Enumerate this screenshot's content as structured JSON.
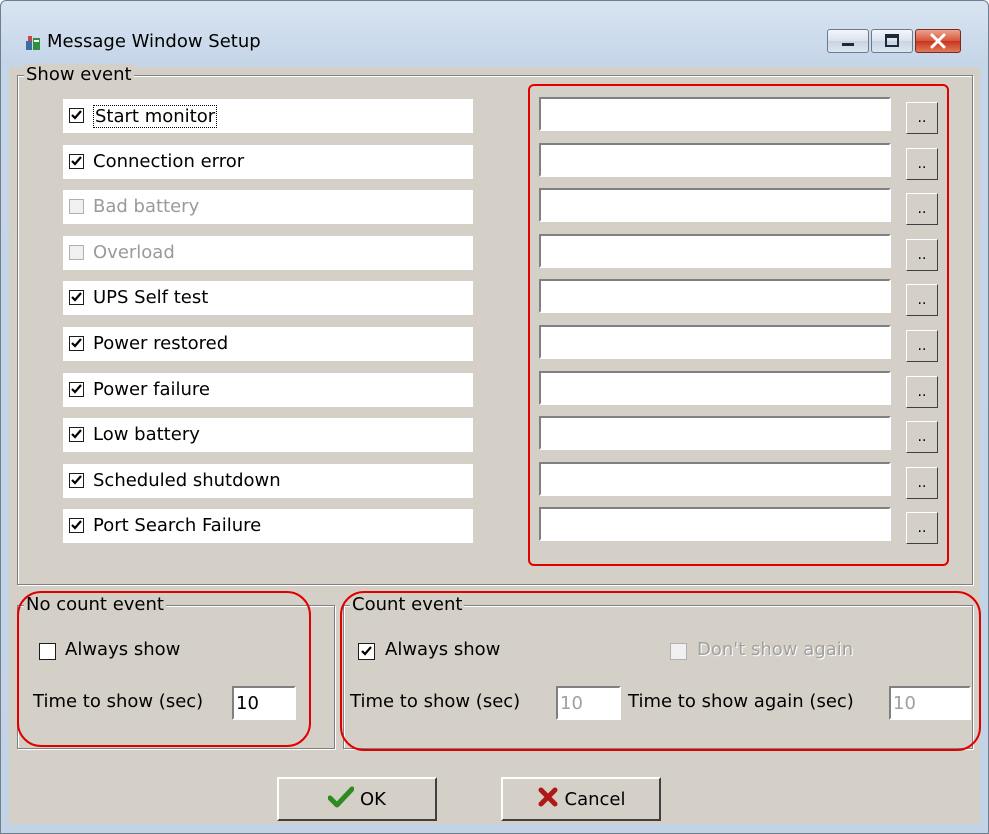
{
  "window": {
    "title": "Message Window Setup",
    "min_glyph": "▭",
    "max_glyph": "□",
    "close_glyph": "✕"
  },
  "show_event": {
    "label": "Show event",
    "browse_label": "..",
    "items": [
      {
        "label": "Start monitor",
        "checked": true,
        "enabled": true,
        "path": ""
      },
      {
        "label": "Connection error",
        "checked": true,
        "enabled": true,
        "path": ""
      },
      {
        "label": "Bad battery",
        "checked": false,
        "enabled": false,
        "path": ""
      },
      {
        "label": "Overload",
        "checked": false,
        "enabled": false,
        "path": ""
      },
      {
        "label": "UPS Self test",
        "checked": true,
        "enabled": true,
        "path": ""
      },
      {
        "label": "Power restored",
        "checked": true,
        "enabled": true,
        "path": ""
      },
      {
        "label": "Power failure",
        "checked": true,
        "enabled": true,
        "path": ""
      },
      {
        "label": "Low battery",
        "checked": true,
        "enabled": true,
        "path": ""
      },
      {
        "label": "Scheduled shutdown",
        "checked": true,
        "enabled": true,
        "path": ""
      },
      {
        "label": "Port Search Failure",
        "checked": true,
        "enabled": true,
        "path": ""
      }
    ]
  },
  "no_count_event": {
    "label": "No count event",
    "always_show_label": "Always show",
    "always_show_checked": false,
    "time_label": "Time to show (sec)",
    "time_value": "10"
  },
  "count_event": {
    "label": "Count event",
    "always_show_label": "Always show",
    "always_show_checked": true,
    "dont_show_label": "Don't show again",
    "dont_show_checked": false,
    "time_label": "Time to show (sec)",
    "time_value": "10",
    "time_again_label": "Time to show again (sec)",
    "time_again_value": "10"
  },
  "buttons": {
    "ok": "OK",
    "cancel": "Cancel"
  },
  "colors": {
    "highlight_border": "#e00000",
    "dialog_face": "#d4d0c8",
    "ok_check": "#2e8b1f",
    "cancel_x": "#b01818"
  }
}
